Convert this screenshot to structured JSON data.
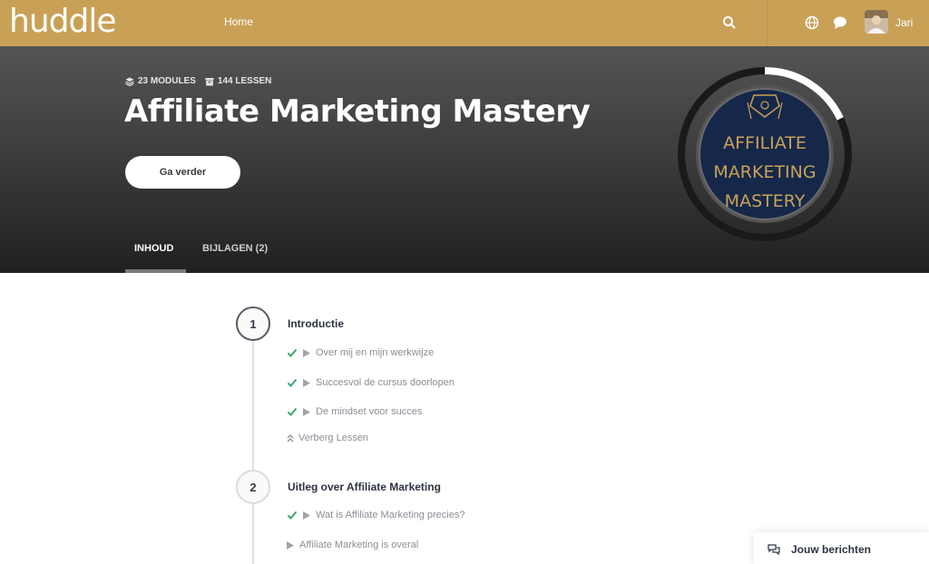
{
  "navbar": {
    "logo": "huddle",
    "home_label": "Home",
    "user_name": "Jari",
    "icons": [
      "search-icon",
      "globe-icon",
      "chat-icon"
    ]
  },
  "hero": {
    "modules_label": "23 MODULES",
    "lessons_label": "144 LESSEN",
    "title": "Affiliate Marketing Mastery",
    "continue_label": "Ga verder",
    "badge_lines": [
      "AFFILIATE",
      "MARKETING",
      "MASTERY"
    ],
    "progress": 0.18,
    "tabs": [
      {
        "label": "INHOUD",
        "active": true
      },
      {
        "label": "BIJLAGEN (2)",
        "active": false
      }
    ]
  },
  "modules": [
    {
      "number": "1",
      "title": "Introductie",
      "lessons": [
        {
          "label": "Over mij en mijn werkwijze",
          "completed": true
        },
        {
          "label": "Succesvol de cursus doorlopen",
          "completed": true
        },
        {
          "label": "De mindset voor succes",
          "completed": true
        }
      ],
      "toggle_label": "Verberg Lessen"
    },
    {
      "number": "2",
      "title": "Uitleg over Affiliate Marketing",
      "lessons": [
        {
          "label": "Wat is Affiliate Marketing precies?",
          "completed": true
        },
        {
          "label": "Affiliate Marketing is overal",
          "completed": false
        }
      ]
    }
  ],
  "messages_widget": {
    "label": "Jouw berichten"
  },
  "colors": {
    "navbar": "#c9a156",
    "check": "#3aa86b",
    "badge_bg": "#16284a",
    "badge_text": "#c9a156"
  }
}
